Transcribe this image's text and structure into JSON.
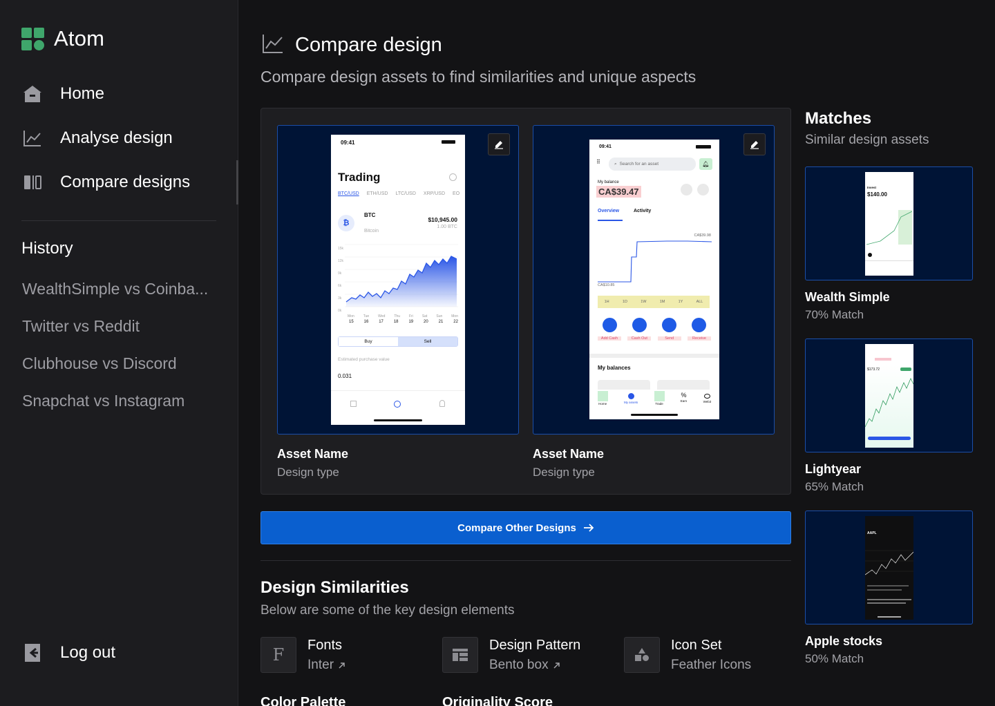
{
  "brand": {
    "name": "Atom",
    "color": "#3fa66b"
  },
  "nav": [
    {
      "label": "Home",
      "icon": "home-icon"
    },
    {
      "label": "Analyse design",
      "icon": "chart-icon"
    },
    {
      "label": "Compare designs",
      "icon": "columns-icon"
    }
  ],
  "history": {
    "title": "History",
    "items": [
      "WealthSimple vs Coinba...",
      "Twitter vs Reddit",
      "Clubhouse vs Discord",
      "Snapchat vs Instagram"
    ]
  },
  "logout": "Log out",
  "page": {
    "title": "Compare design",
    "subtitle": "Compare design assets to find similarities and unique aspects"
  },
  "assets": [
    {
      "name": "Asset Name",
      "type": "Design type"
    },
    {
      "name": "Asset Name",
      "type": "Design type"
    }
  ],
  "phone1": {
    "time": "09:41",
    "title": "Trading",
    "tabs": [
      "BTC/USD",
      "ETH/USD",
      "LTC/USD",
      "XRP/USD",
      "EO"
    ],
    "coin": "BTC",
    "coin_sub": "Bitcoin",
    "price": "$10,945.00",
    "amount": "1.00 BTC",
    "y_ticks": [
      "15k",
      "12k",
      "9k",
      "6k",
      "3k",
      "0k"
    ],
    "days": [
      "Mon",
      "Tue",
      "Wed",
      "Thu",
      "Fri",
      "Sat",
      "Sun",
      "Mon"
    ],
    "dates": [
      "15",
      "16",
      "17",
      "18",
      "19",
      "20",
      "21",
      "22"
    ],
    "buy": "Buy",
    "sell": "Sell",
    "est_label": "Estimated purchase value",
    "est_value": "0.031"
  },
  "phone2": {
    "time": "09:41",
    "search": "Search for an asset",
    "balance_label": "My balance",
    "balance": "CA$39.47",
    "tabs": [
      "Overview",
      "Activity"
    ],
    "high": "CA$39.98",
    "low": "CA$10.85",
    "ranges": [
      "1H",
      "1D",
      "1W",
      "1M",
      "1Y",
      "ALL"
    ],
    "actions": [
      "Add Cash",
      "Cash Out",
      "Send",
      "Receive"
    ],
    "section": "My balances",
    "bottom_nav": [
      "Home",
      "My assets",
      "Trade",
      "Earn",
      "Web3"
    ]
  },
  "cta": "Compare Other Designs",
  "similarities": {
    "title": "Design Similarities",
    "subtitle": "Below are some of the key design elements",
    "items": [
      {
        "label": "Fonts",
        "value": "Inter",
        "icon": "font-icon",
        "link": true
      },
      {
        "label": "Design Pattern",
        "value": "Bento box",
        "icon": "layout-icon",
        "link": true
      },
      {
        "label": "Icon Set",
        "value": "Feather Icons",
        "icon": "shapes-icon",
        "link": false
      }
    ],
    "more": [
      "Color Palette",
      "Originality Score"
    ]
  },
  "matches": {
    "title": "Matches",
    "subtitle": "Similar design assets",
    "items": [
      {
        "name": "Wealth Simple",
        "pct": "70% Match",
        "mini_title": "Invest",
        "mini_value": "$140.00"
      },
      {
        "name": "Lightyear",
        "pct": "65% Match",
        "mini_value": "$173.72"
      },
      {
        "name": "Apple stocks",
        "pct": "50% Match",
        "mini_title": "AAPL"
      }
    ]
  }
}
